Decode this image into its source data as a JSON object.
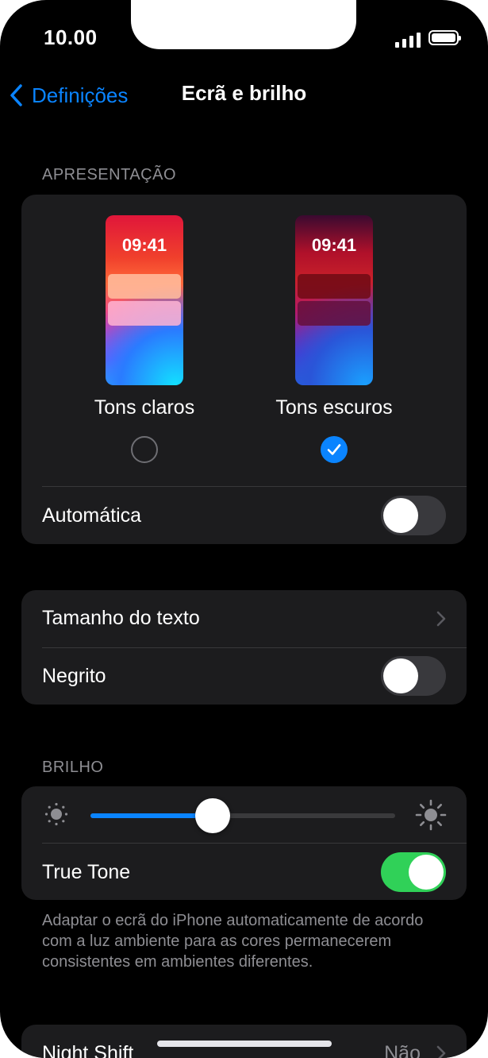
{
  "status_bar": {
    "time": "10.00"
  },
  "nav": {
    "back_label": "Definições",
    "title": "Ecrã e brilho"
  },
  "appearance": {
    "header": "APRESENTAÇÃO",
    "clock": "09:41",
    "light_label": "Tons claros",
    "dark_label": "Tons escuros",
    "selected": "dark",
    "automatic_label": "Automática",
    "automatic_on": false
  },
  "text": {
    "text_size_label": "Tamanho do texto",
    "bold_label": "Negrito",
    "bold_on": false
  },
  "brightness": {
    "header": "BRILHO",
    "level": 0.4,
    "true_tone_label": "True Tone",
    "true_tone_on": true,
    "note": "Adaptar o ecrã do iPhone automaticamente de acordo com a luz ambiente para as cores permanecerem consistentes em ambientes diferentes."
  },
  "night_shift": {
    "label": "Night Shift",
    "value": "Não"
  },
  "colors": {
    "accent": "#0a84ff",
    "toggle_on": "#30d158",
    "background": "#000000",
    "group_bg": "#1c1c1e"
  }
}
